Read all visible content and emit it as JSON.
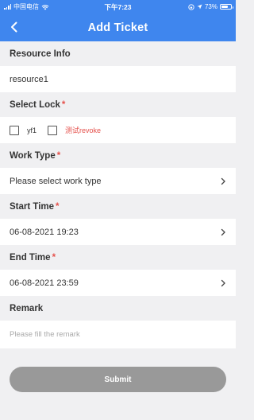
{
  "status_bar": {
    "carrier": "中国电信",
    "time": "下午7:23",
    "battery": "73%"
  },
  "nav": {
    "title": "Add Ticket",
    "back_icon": "chevron-left-icon"
  },
  "resource": {
    "label": "Resource Info",
    "value": "resource1"
  },
  "lock": {
    "label": "Select Lock",
    "required": "*",
    "options": [
      {
        "label": "yf1",
        "color": "#333333"
      },
      {
        "label": "测试revoke",
        "color": "#e5514c"
      }
    ]
  },
  "work_type": {
    "label": "Work Type",
    "required": "*",
    "value": "Please select work type"
  },
  "start_time": {
    "label": "Start Time",
    "required": "*",
    "value": "06-08-2021 19:23"
  },
  "end_time": {
    "label": "End Time",
    "required": "*",
    "value": "06-08-2021 23:59"
  },
  "remark": {
    "label": "Remark",
    "placeholder": "Please fill the remark"
  },
  "submit_label": "Submit",
  "colors": {
    "primary": "#3f86ee",
    "required": "#e5514c",
    "submit_bg": "#999999",
    "page_bg": "#f0f0f2"
  }
}
